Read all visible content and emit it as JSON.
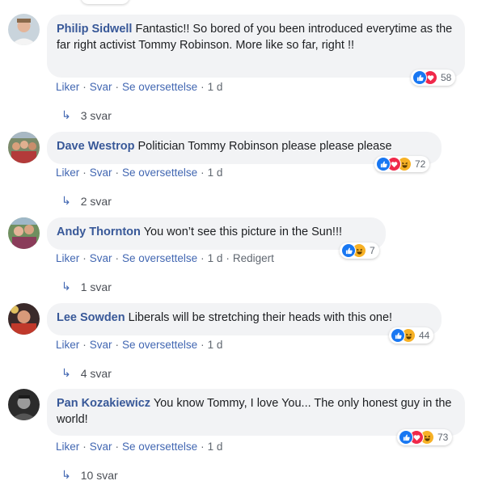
{
  "actions": {
    "like": "Liker",
    "reply": "Svar",
    "translate": "Se oversettelse",
    "edited": "Redigert"
  },
  "comments": [
    {
      "name": "Philip Sidwell",
      "text": "Fantastic!! So bored of you been introduced everytime as the far right activist Tommy Robinson. More like so far, right !!",
      "time": "1 d",
      "reaction_count": "58",
      "reactions": [
        "like-icon",
        "love-icon"
      ],
      "replies": "3 svar"
    },
    {
      "name": "Dave Westrop",
      "text": "Politician Tommy Robinson please please please",
      "time": "1 d",
      "reaction_count": "72",
      "reactions": [
        "like-icon",
        "love-icon",
        "haha-icon"
      ],
      "replies": "2 svar"
    },
    {
      "name": "Andy Thornton",
      "text": "You won’t see this picture in the Sun!!!",
      "time": "1 d",
      "reaction_count": "7",
      "reactions": [
        "like-icon",
        "haha-icon"
      ],
      "replies": "1 svar"
    },
    {
      "name": "Lee Sowden",
      "text": "Liberals will be stretching their heads with this one!",
      "time": "1 d",
      "reaction_count": "44",
      "reactions": [
        "like-icon",
        "haha-icon"
      ],
      "replies": "4 svar"
    },
    {
      "name": "Pan Kozakiewicz",
      "text": "You know Tommy, I love You... The only honest guy in the world!",
      "time": "1 d",
      "reaction_count": "73",
      "reactions": [
        "like-icon",
        "love-icon",
        "haha-icon"
      ],
      "replies": "10 svar"
    }
  ],
  "colors": {
    "name": "#385898",
    "action": "#4267b2",
    "bubble": "#f2f3f5",
    "like": "#1877f2",
    "love": "#f0284a",
    "haha": "#f7b125"
  }
}
